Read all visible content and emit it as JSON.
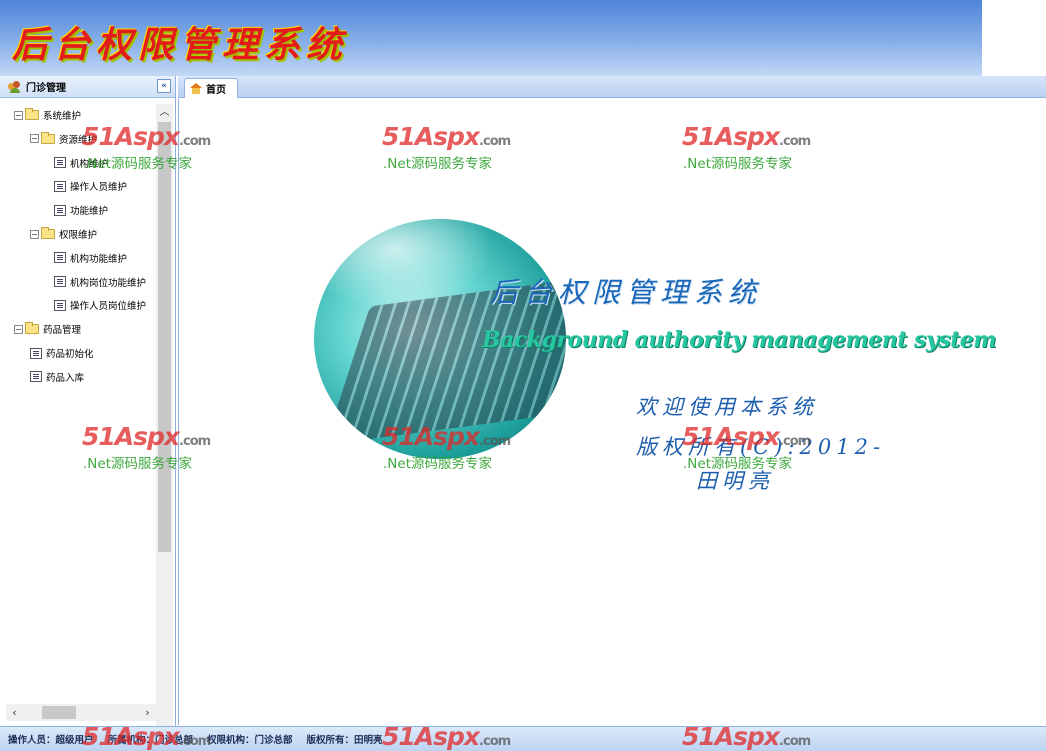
{
  "header": {
    "title": "后台权限管理系统"
  },
  "sidebar": {
    "title": "门诊管理",
    "collapse_glyph": "«",
    "tree": [
      {
        "label": "系统维护",
        "level": 0,
        "type": "folder",
        "expanded": true
      },
      {
        "label": "资源维护",
        "level": 1,
        "type": "folder",
        "expanded": true
      },
      {
        "label": "机构维护",
        "level": 2,
        "type": "leaf"
      },
      {
        "label": "操作人员维护",
        "level": 2,
        "type": "leaf"
      },
      {
        "label": "功能维护",
        "level": 2,
        "type": "leaf"
      },
      {
        "label": "权限维护",
        "level": 1,
        "type": "folder",
        "expanded": true
      },
      {
        "label": "机构功能维护",
        "level": 2,
        "type": "leaf"
      },
      {
        "label": "机构岗位功能维护",
        "level": 2,
        "type": "leaf"
      },
      {
        "label": "操作人员岗位维护",
        "level": 2,
        "type": "leaf"
      },
      {
        "label": "药品管理",
        "level": 0,
        "type": "folder",
        "expanded": true
      },
      {
        "label": "药品初始化",
        "level": 1,
        "type": "leaf"
      },
      {
        "label": "药品入库",
        "level": 1,
        "type": "leaf"
      }
    ]
  },
  "tabs": [
    {
      "label": "首页",
      "icon": "home-icon",
      "active": true
    }
  ],
  "welcome": {
    "title": "后台权限管理系统",
    "subtitle": "Background authority management system",
    "line1": "欢迎使用本系统",
    "line2": "版权所有(C):2012-",
    "line3": "田明亮"
  },
  "watermark": {
    "brand": "51Aspx",
    "domain": ".com",
    "tagline": ".Net源码服务专家"
  },
  "status": {
    "operator": "操作人员：超级用户",
    "org": "所属机构：门诊总部",
    "perm_org": "权限机构：门诊总部",
    "copyright": "版权所有：田明亮"
  },
  "colors": {
    "header_top": "#4f84d8",
    "header_title": "#e31b1b",
    "accent": "#8db2e3",
    "watermark_red": "#e02828",
    "watermark_green": "#2aa02a"
  }
}
